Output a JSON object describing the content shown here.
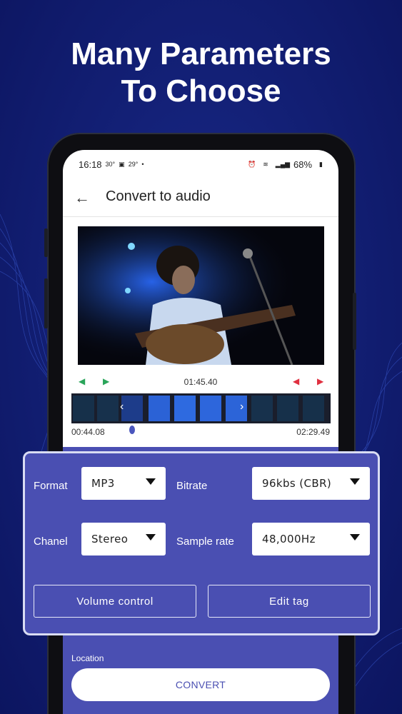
{
  "headline": {
    "line1": "Many Parameters",
    "line2": "To Choose"
  },
  "status_bar": {
    "time": "16:18",
    "temp": "30°",
    "temp2": "29°",
    "battery": "68%"
  },
  "app_bar": {
    "title": "Convert to audio",
    "back_icon": "arrow-left-icon"
  },
  "trimmer": {
    "current_time": "01:45.40",
    "start_time": "00:44.08",
    "end_time": "02:29.49"
  },
  "params": {
    "format_label": "Format",
    "format_value": "MP3",
    "bitrate_label": "Bitrate",
    "bitrate_value": "96kbs (CBR)",
    "channel_label": "Chanel",
    "channel_value": "Stereo",
    "sample_rate_label": "Sample rate",
    "sample_rate_value": "48,000Hz",
    "volume_button": "Volume control",
    "edit_tag_button": "Edit tag"
  },
  "footer": {
    "location_label": "Location",
    "convert_button": "CONVERT"
  },
  "colors": {
    "accent": "#4a4fb2",
    "background": "#132076",
    "trim_green": "#2aa55a",
    "trim_red": "#e03040"
  }
}
